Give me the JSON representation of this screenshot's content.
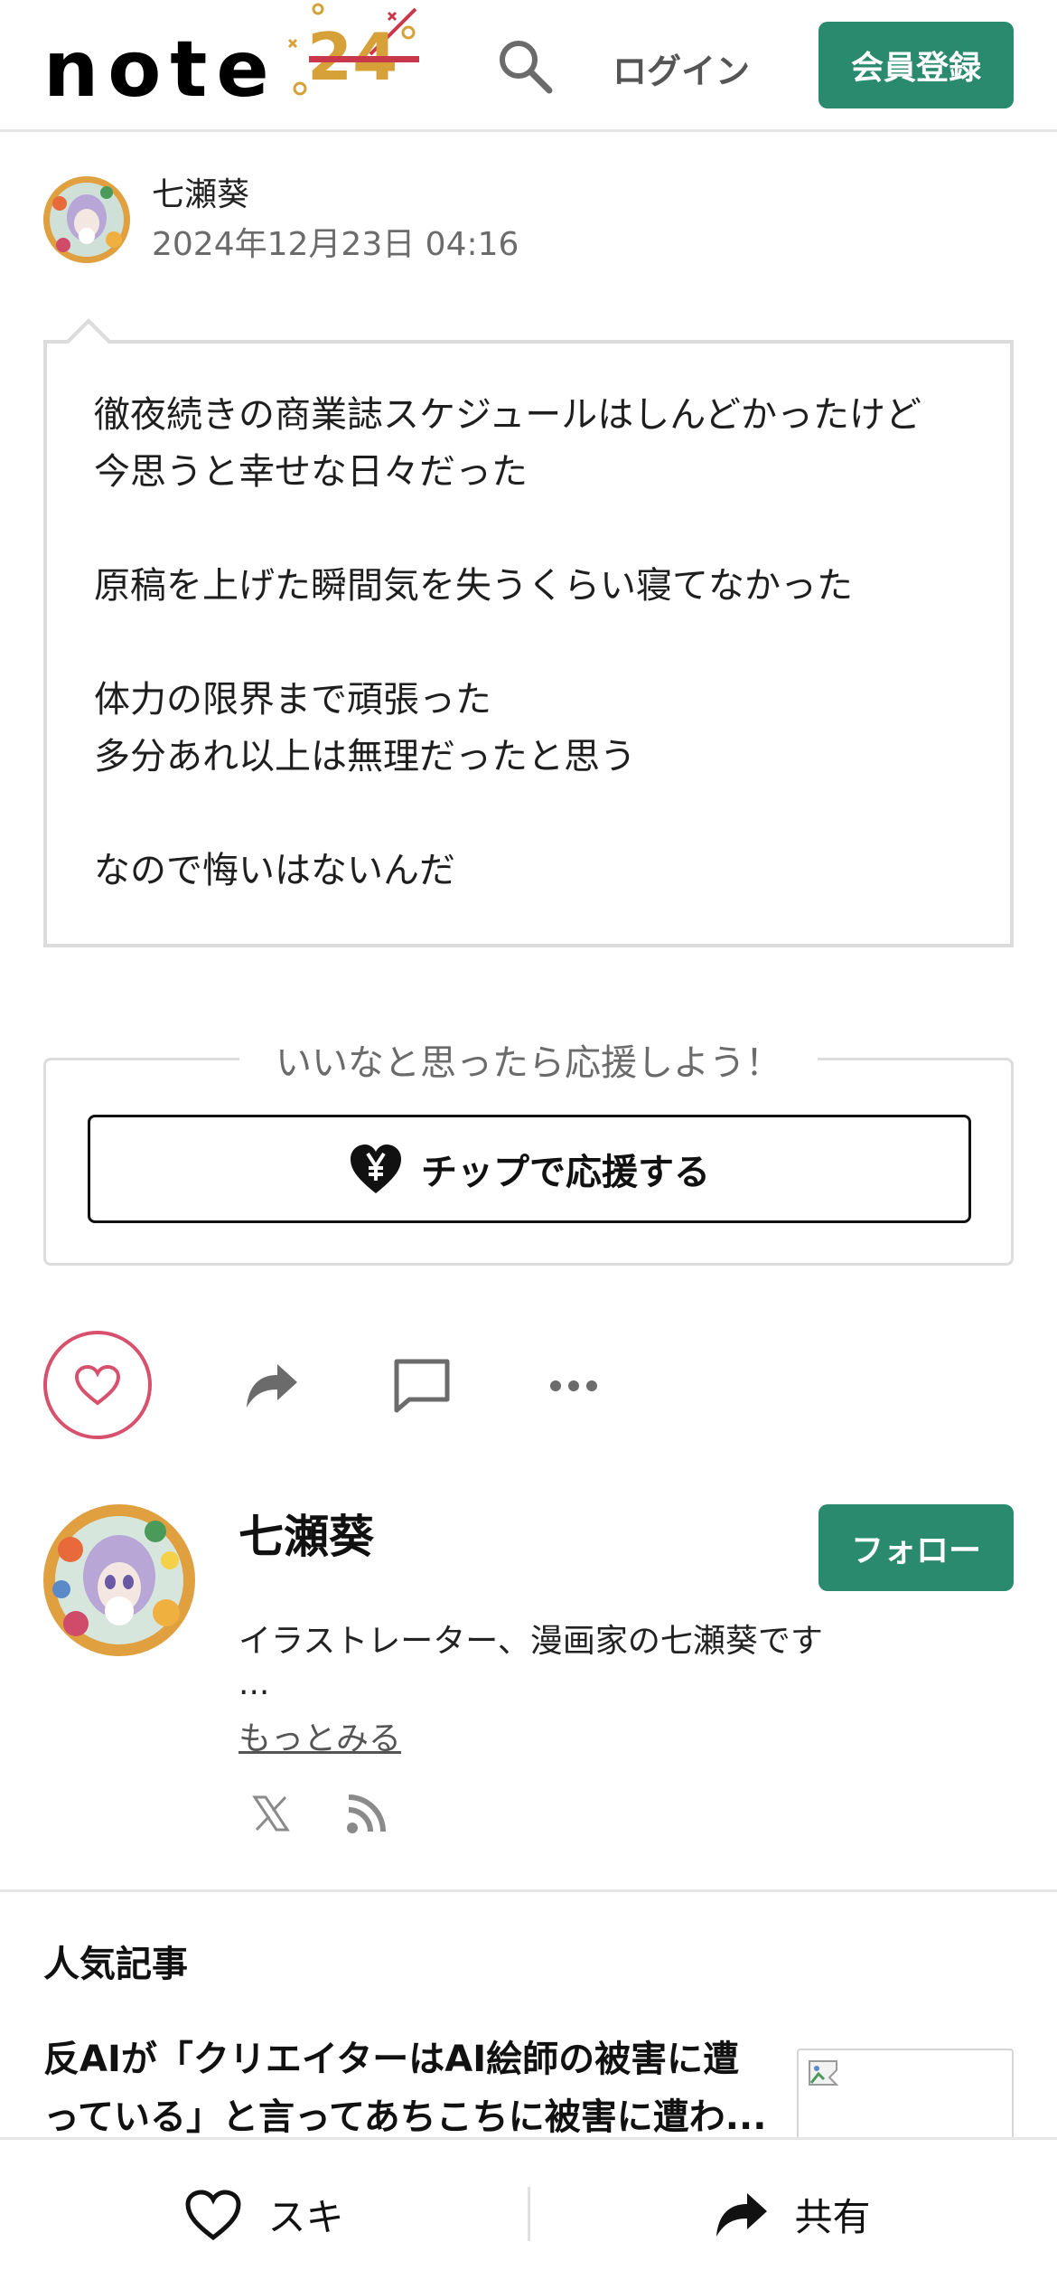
{
  "header": {
    "logo_text": "note",
    "logo_badge_text": "24",
    "login_label": "ログイン",
    "signup_label": "会員登録"
  },
  "post": {
    "author_name": "七瀬葵",
    "date": "2024年12月23日 04:16",
    "lines": [
      "徹夜続きの商業誌スケジュールはしんどかったけど",
      "今思うと幸せな日々だった",
      "",
      "原稿を上げた瞬間気を失うくらい寝てなかった",
      "",
      "体力の限界まで頑張った",
      "多分あれ以上は無理だったと思う",
      "",
      "なので悔いはないんだ"
    ]
  },
  "tip": {
    "caption": "いいなと思ったら応援しよう！",
    "button_label": "チップで応援する"
  },
  "creator": {
    "name": "七瀬葵",
    "follow_label": "フォロー",
    "bio": "イラストレーター、漫画家の七瀬葵です",
    "bio_ellipsis": "...",
    "more_label": "もっとみる"
  },
  "popular": {
    "title": "人気記事",
    "article_lines": [
      "反AIが「クリエイターはAI絵師の被害に遭",
      "っている」と言ってあちこちに被害に遭わ..."
    ]
  },
  "bottom_bar": {
    "like_label": "スキ",
    "share_label": "共有"
  },
  "colors": {
    "brand_green": "#2a8a6e",
    "like_pink": "#d7506c"
  }
}
